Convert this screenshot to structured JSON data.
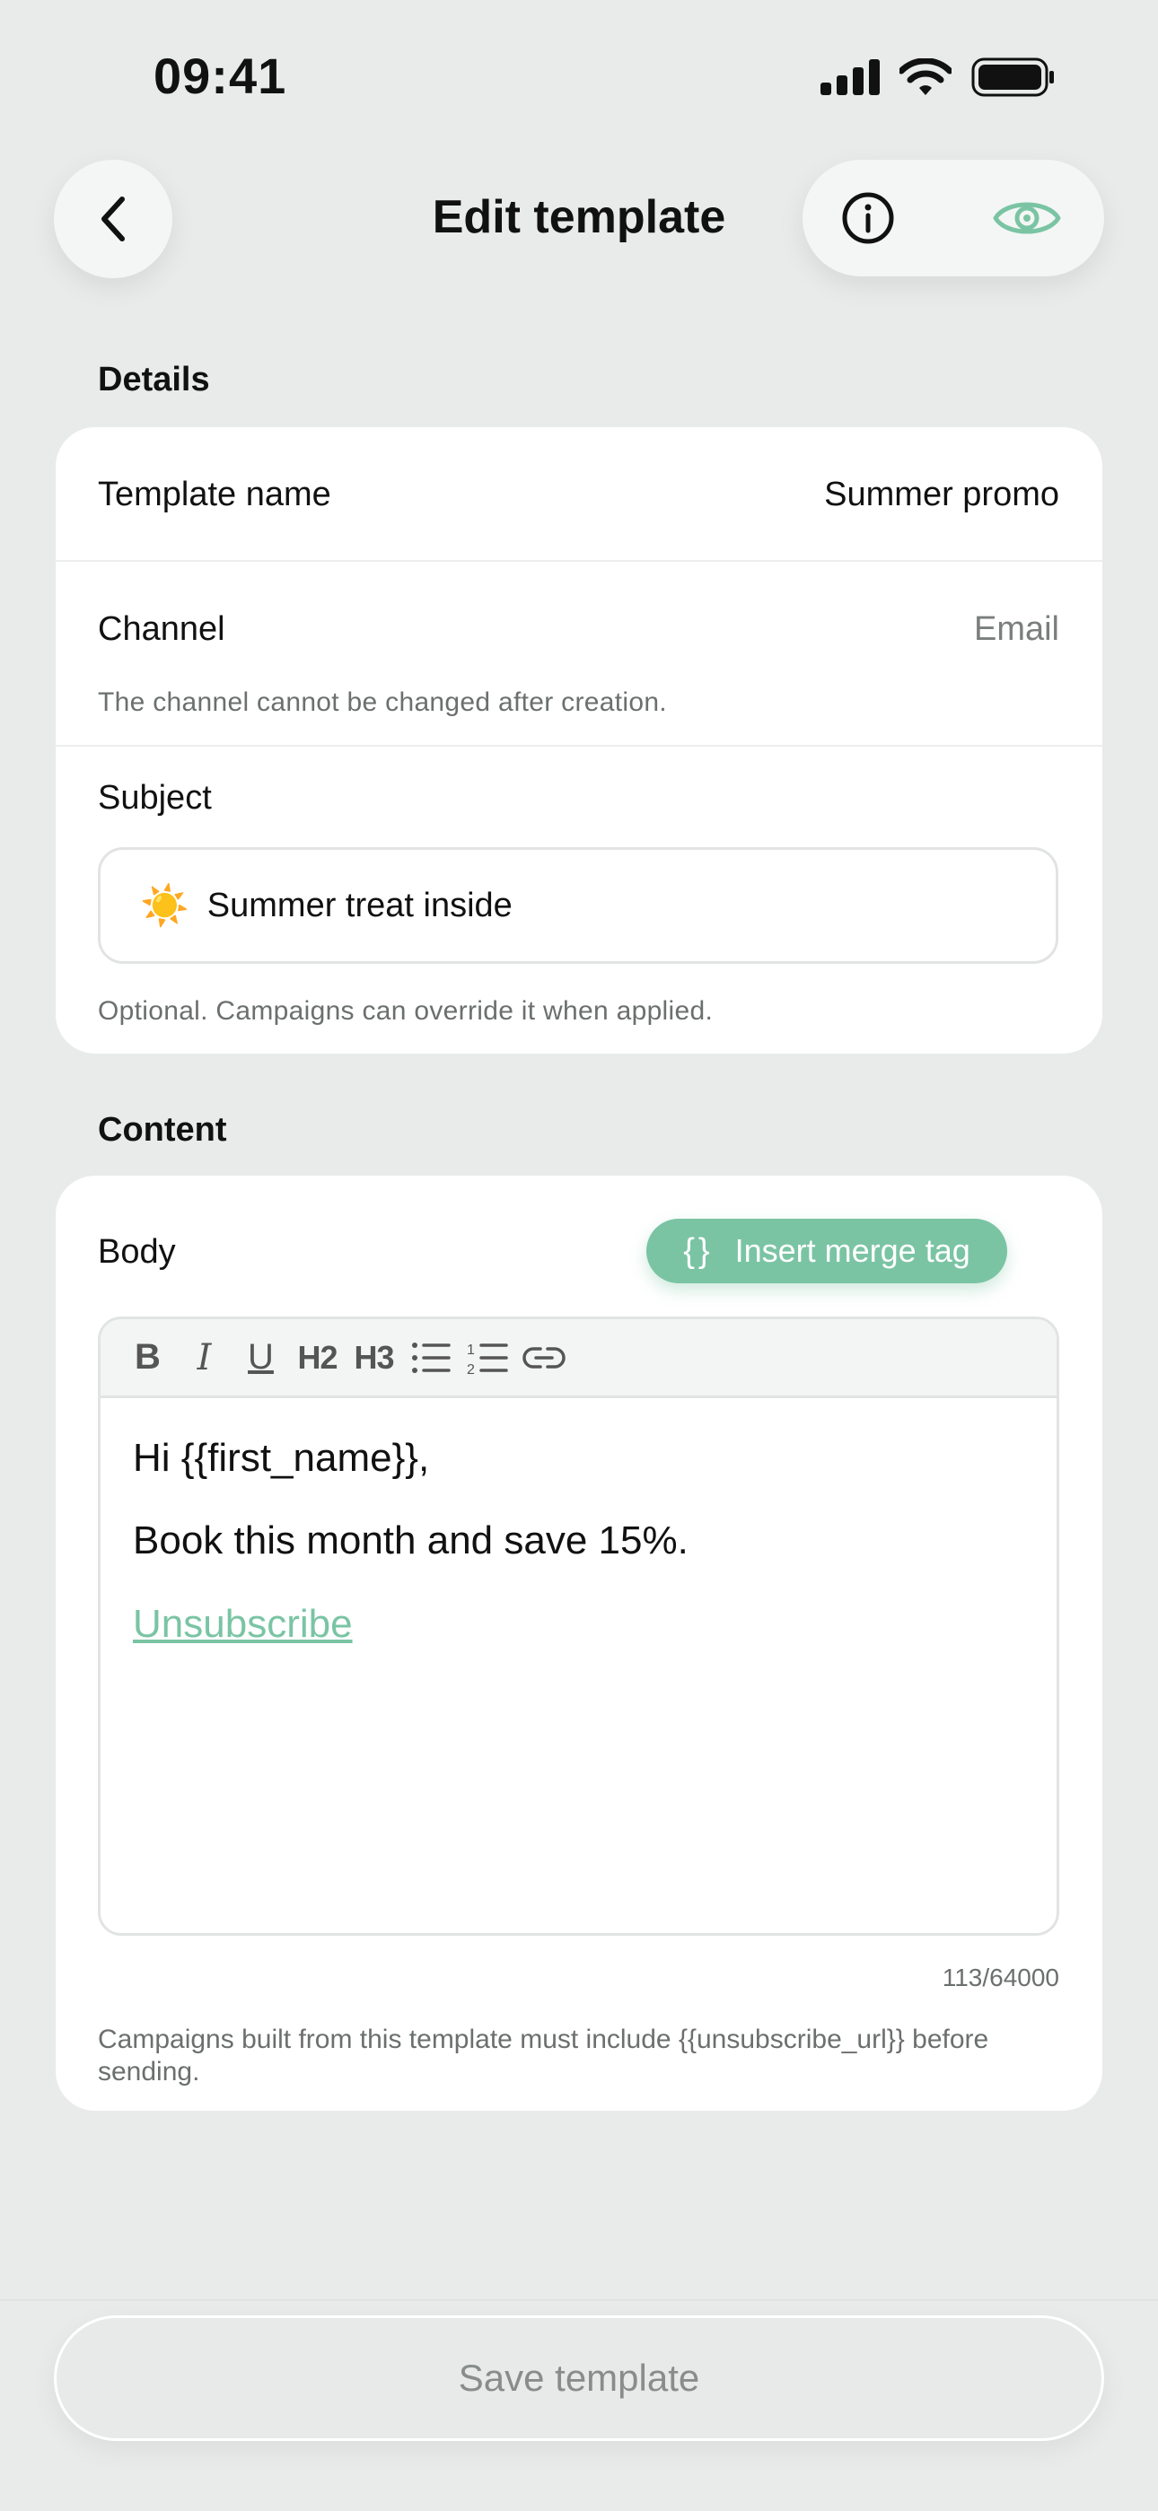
{
  "status_bar": {
    "time": "09:41"
  },
  "header": {
    "title": "Edit template"
  },
  "details": {
    "section_label": "Details",
    "template_name_label": "Template name",
    "template_name_value": "Summer promo",
    "channel_label": "Channel",
    "channel_value": "Email",
    "channel_hint": "The channel cannot be changed after creation.",
    "subject_label": "Subject",
    "subject_emoji": "☀️",
    "subject_value": "Summer treat inside",
    "subject_hint": "Optional. Campaigns can override it when applied."
  },
  "content": {
    "section_label": "Content",
    "body_label": "Body",
    "merge_button_icon": "{}",
    "merge_button_label": "Insert merge tag",
    "toolbar": [
      "B",
      "I",
      "U",
      "H2",
      "H3",
      "bulleted-list",
      "numbered-list",
      "link"
    ],
    "body_lines": [
      "Hi {{first_name}},",
      "Book this month and save 15%.",
      "Unsubscribe"
    ],
    "counter": "113/64000",
    "footnote": "Campaigns built from this template must include {{unsubscribe_url}} before sending."
  },
  "footer": {
    "save_label": "Save template"
  },
  "colors": {
    "accent": "#7ac4a4",
    "background": "#e8ebea",
    "card": "#ffffff"
  }
}
